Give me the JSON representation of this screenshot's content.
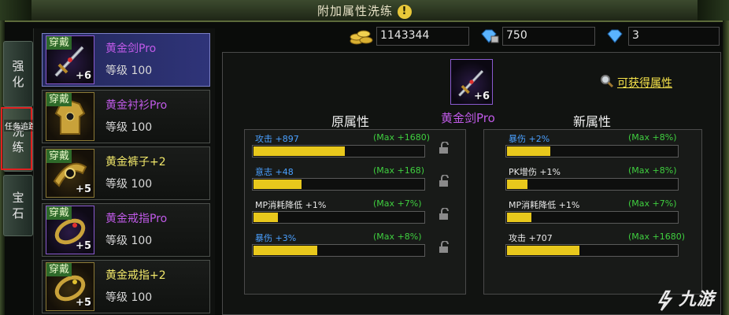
{
  "window": {
    "title": "附加属性洗练"
  },
  "side_tabs": [
    {
      "label": [
        "强",
        "化"
      ]
    },
    {
      "label": [
        "洗",
        "练"
      ]
    },
    {
      "label": [
        "宝",
        "石"
      ]
    }
  ],
  "task_label": "任务追踪",
  "items": [
    {
      "tag": "穿戴",
      "plus": "+6",
      "name": "黄金剑Pro",
      "level": "等级 100"
    },
    {
      "tag": "穿戴",
      "plus": "",
      "name": "黄金衬衫Pro",
      "level": "等级 100"
    },
    {
      "tag": "穿戴",
      "plus": "+5",
      "name": "黄金裤子+2",
      "level": "等级 100"
    },
    {
      "tag": "穿戴",
      "plus": "+5",
      "name": "黄金戒指Pro",
      "level": "等级 100"
    },
    {
      "tag": "穿戴",
      "plus": "+5",
      "name": "黄金戒指+2",
      "level": "等级 100"
    }
  ],
  "currency": {
    "gold": "1143344",
    "bound_diamond": "750",
    "diamond": "3"
  },
  "equipped": {
    "name": "黄金剑Pro",
    "plus": "+6"
  },
  "obtain_link": "可获得属性",
  "original": {
    "title": "原属性",
    "stats": [
      {
        "label": "攻击 +897",
        "max": "(Max +1680)",
        "fill": 0.53
      },
      {
        "label": "意志 +48",
        "max": "(Max +168)",
        "fill": 0.28
      },
      {
        "label": "MP消耗降低 +1%",
        "max": "(Max +7%)",
        "fill": 0.14
      },
      {
        "label": "暴伤 +3%",
        "max": "(Max +8%)",
        "fill": 0.37
      }
    ]
  },
  "new": {
    "title": "新属性",
    "stats": [
      {
        "label": "暴伤 +2%",
        "max": "(Max +8%)",
        "fill": 0.25
      },
      {
        "label": "PK增伤 +1%",
        "max": "(Max +8%)",
        "fill": 0.12
      },
      {
        "label": "MP消耗降低 +1%",
        "max": "(Max +7%)",
        "fill": 0.14
      },
      {
        "label": "攻击 +707",
        "max": "(Max +1680)",
        "fill": 0.42
      }
    ]
  },
  "watermark": "九游",
  "colors": {
    "gold_bar": "#e8c81c",
    "purple_quality": "#c05ae8",
    "max_green": "#3fcf3f",
    "blue_stat": "#4aa0ff"
  }
}
